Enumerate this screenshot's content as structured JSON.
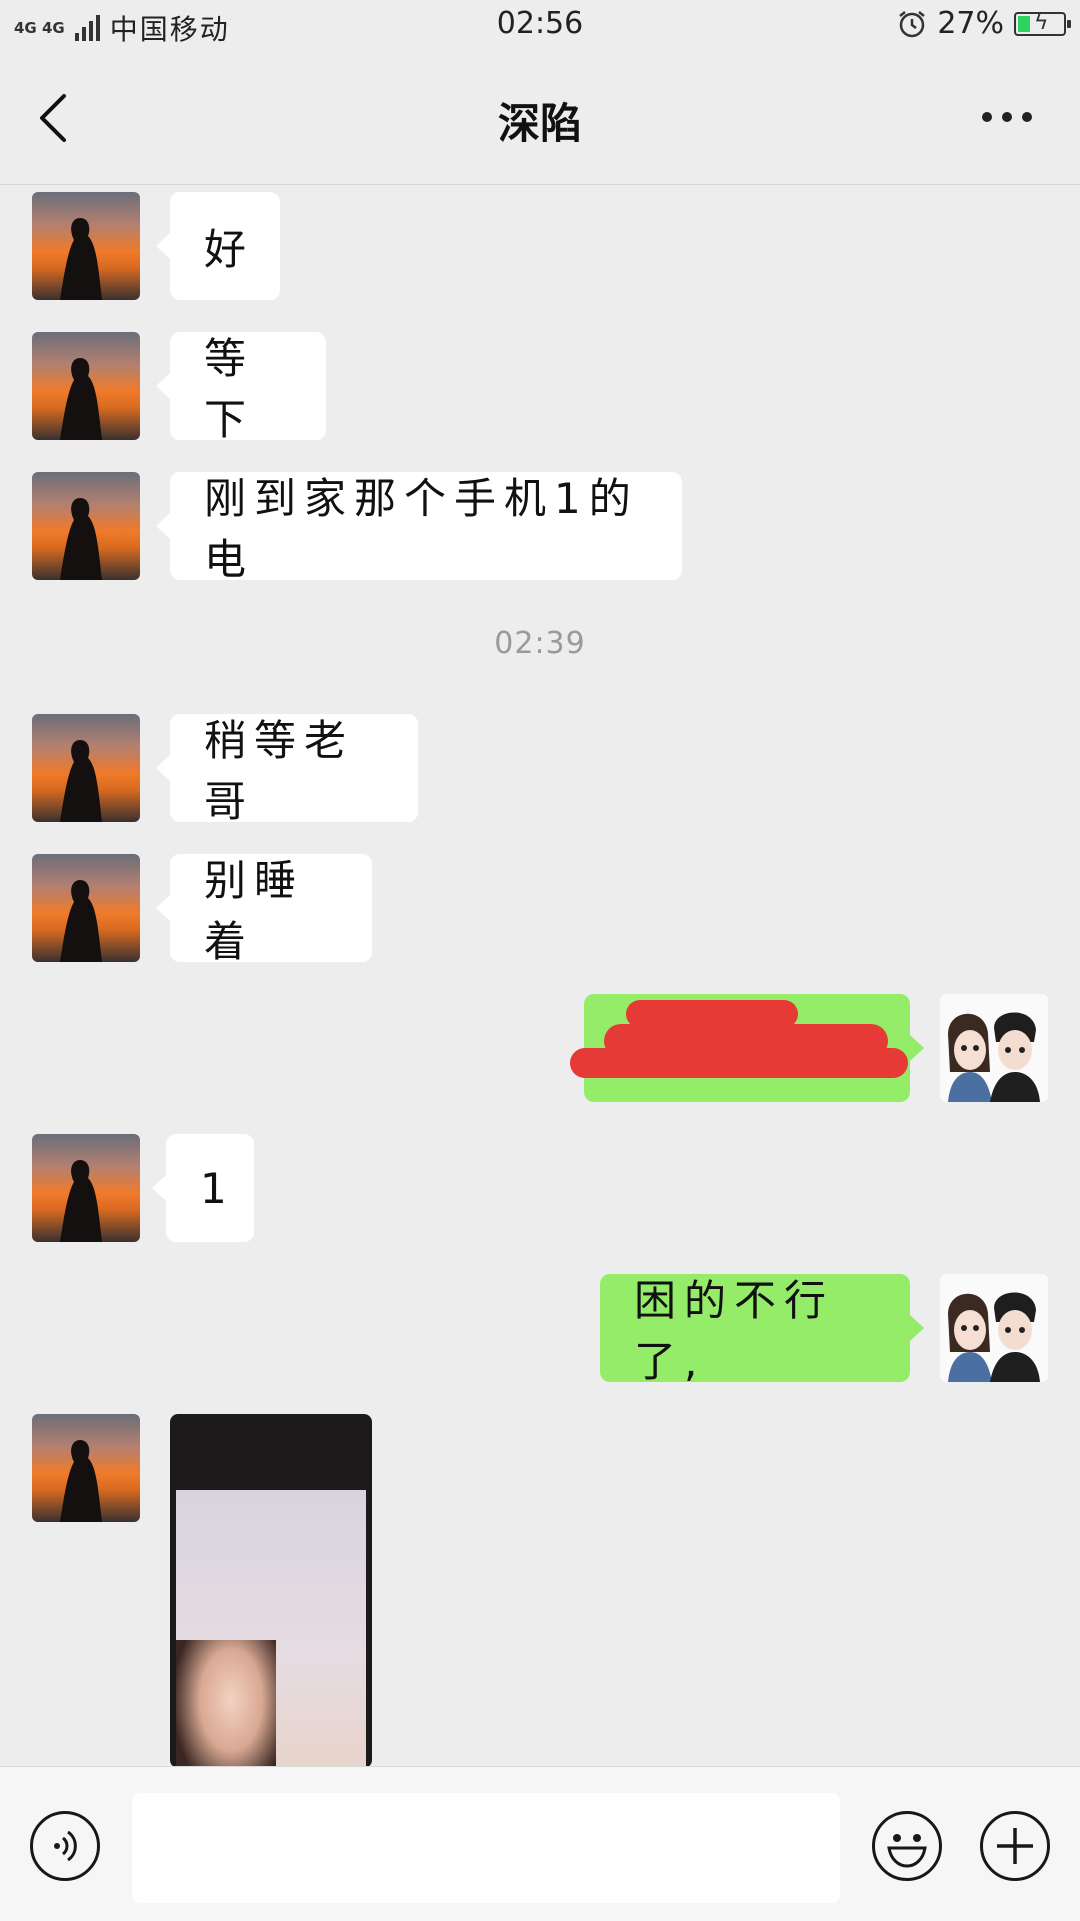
{
  "status_bar": {
    "network": "4G 4G",
    "carrier": "中国移动",
    "time": "02:56",
    "battery_percent": "27%",
    "battery_level": 0.27,
    "icons": [
      "signal-icon",
      "alarm-icon",
      "battery-charging-icon"
    ]
  },
  "nav": {
    "title": "深陷",
    "back_icon": "chevron-left-icon",
    "more_icon": "more-dots-icon"
  },
  "messages": [
    {
      "side": "left",
      "text": "好"
    },
    {
      "side": "left",
      "text": "等下"
    },
    {
      "side": "left",
      "text": "刚到家那个手机1的电"
    },
    {
      "type": "time",
      "text": "02:39"
    },
    {
      "side": "left",
      "text": "稍等老哥"
    },
    {
      "side": "left",
      "text": "别睡着"
    },
    {
      "side": "right",
      "text": "",
      "redacted": true
    },
    {
      "side": "left",
      "text": "1"
    },
    {
      "side": "right",
      "text": "困的不行了,"
    },
    {
      "side": "left",
      "type": "image"
    }
  ],
  "colors": {
    "background": "#ededed",
    "bubble_left": "#ffffff",
    "bubble_right": "#95ec69",
    "redaction": "#e63a36"
  },
  "input_bar": {
    "value": "",
    "icons": [
      "voice-icon",
      "emoji-icon",
      "plus-icon"
    ]
  }
}
